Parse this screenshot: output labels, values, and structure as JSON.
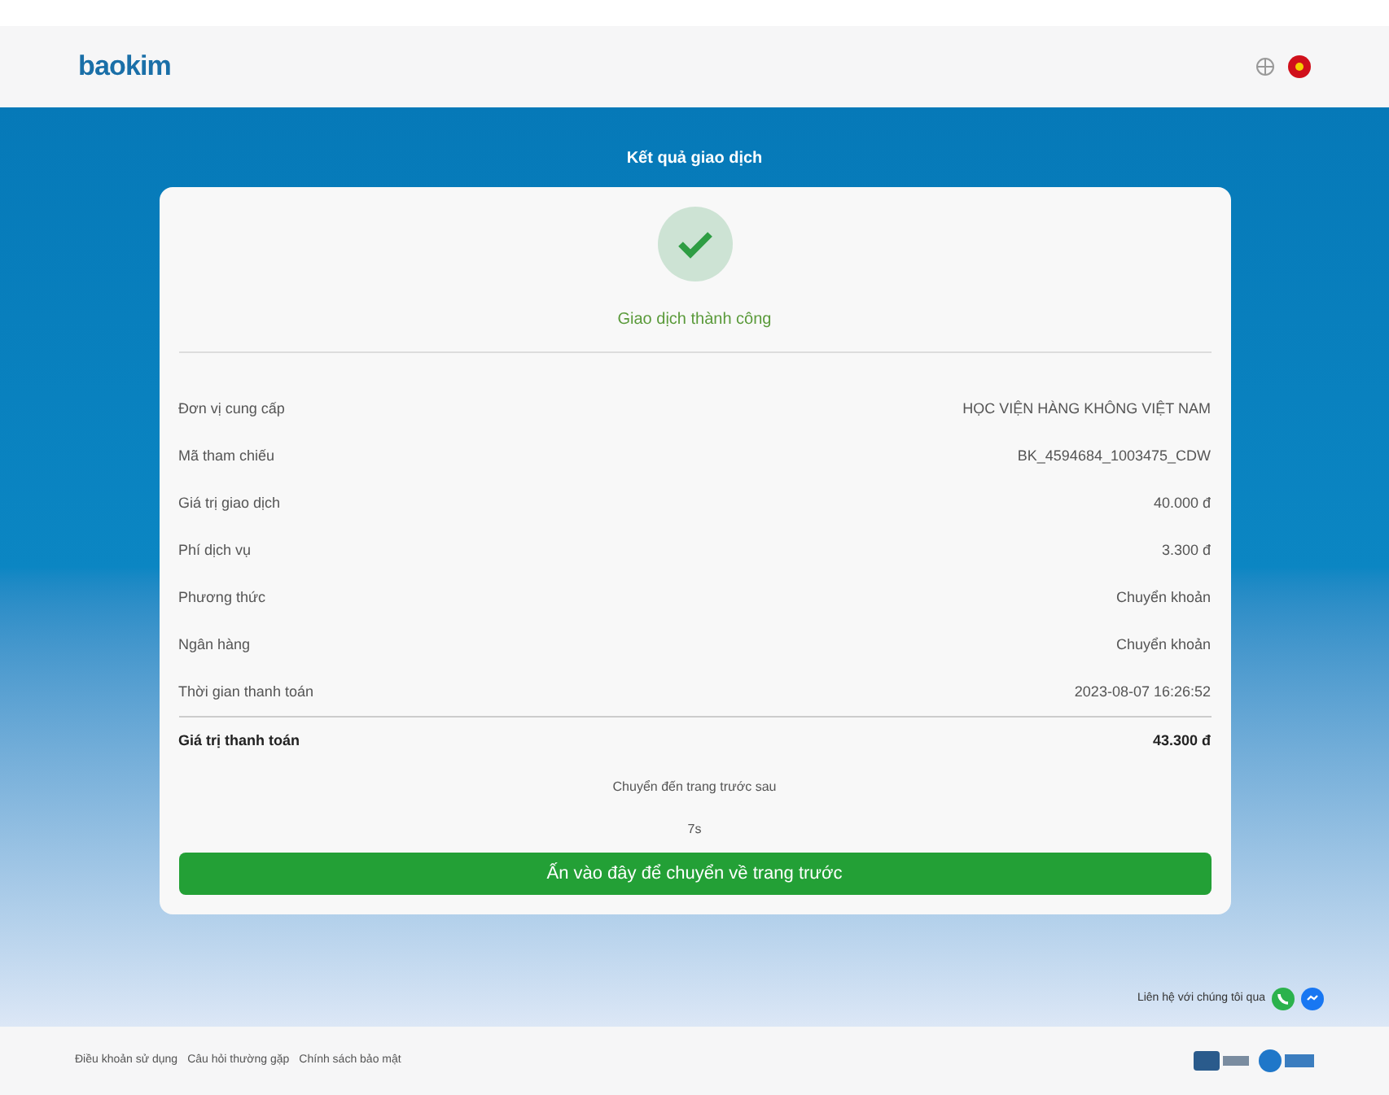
{
  "header": {
    "logo": "baokim"
  },
  "page_title": "Kết quả giao dịch",
  "status": {
    "kind": "success",
    "text": "Giao dịch thành công"
  },
  "details": [
    {
      "label": "Đơn vị cung cấp",
      "value": "HỌC VIỆN HÀNG KHÔNG VIỆT NAM"
    },
    {
      "label": "Mã tham chiếu",
      "value": "BK_4594684_1003475_CDW"
    },
    {
      "label": "Giá trị giao dịch",
      "value": "40.000 đ"
    },
    {
      "label": "Phí dịch vụ",
      "value": "3.300 đ"
    },
    {
      "label": "Phương thức",
      "value": "Chuyển khoản"
    },
    {
      "label": "Ngân hàng",
      "value": "Chuyển khoản"
    },
    {
      "label": "Thời gian thanh toán",
      "value": "2023-08-07 16:26:52"
    }
  ],
  "total": {
    "label": "Giá trị thanh toán",
    "value": "43.300 đ"
  },
  "redirect_note": "Chuyển đến trang trước sau",
  "countdown": "7s",
  "back_button": "Ấn vào đây để chuyển về trang trước",
  "contact": "Liên hệ với chúng tôi qua",
  "footer_links": [
    "Điều khoản sử dụng",
    "Câu hỏi thường gặp",
    "Chính sách bảo mật"
  ]
}
